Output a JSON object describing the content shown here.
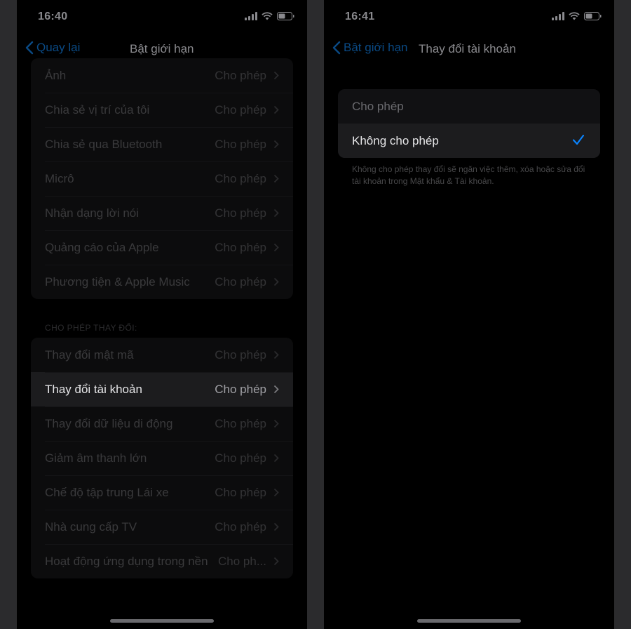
{
  "left": {
    "status": {
      "time": "16:40"
    },
    "nav": {
      "back_label": "Quay lại",
      "title": "Bật giới hạn"
    },
    "privacy_rows": [
      {
        "label": "Ảnh",
        "value": "Cho phép"
      },
      {
        "label": "Chia sẻ vị trí của tôi",
        "value": "Cho phép"
      },
      {
        "label": "Chia sẻ qua Bluetooth",
        "value": "Cho phép"
      },
      {
        "label": "Micrô",
        "value": "Cho phép"
      },
      {
        "label": "Nhận dạng lời nói",
        "value": "Cho phép"
      },
      {
        "label": "Quảng cáo của Apple",
        "value": "Cho phép"
      },
      {
        "label": "Phương tiện & Apple Music",
        "value": "Cho phép"
      }
    ],
    "changes_header": "CHO PHÉP THAY ĐỔI:",
    "change_rows": [
      {
        "label": "Thay đổi mật mã",
        "value": "Cho phép"
      },
      {
        "label": "Thay đổi tài khoản",
        "value": "Cho phép"
      },
      {
        "label": "Thay đổi dữ liệu di động",
        "value": "Cho phép"
      },
      {
        "label": "Giảm âm thanh lớn",
        "value": "Cho phép"
      },
      {
        "label": "Chế độ tập trung Lái xe",
        "value": "Cho phép"
      },
      {
        "label": "Nhà cung cấp TV",
        "value": "Cho phép"
      },
      {
        "label": "Hoạt động ứng dụng trong nền",
        "value": "Cho ph..."
      }
    ]
  },
  "right": {
    "status": {
      "time": "16:41"
    },
    "nav": {
      "back_label": "Bật giới hạn",
      "title": "Thay đổi tài khoản"
    },
    "options": [
      {
        "label": "Cho phép",
        "selected": false
      },
      {
        "label": "Không cho phép",
        "selected": true
      }
    ],
    "footer": "Không cho phép thay đổi sẽ ngăn việc thêm, xóa hoặc sửa đổi tài khoản trong Mật khẩu & Tài khoản."
  },
  "colors": {
    "accent": "#0a84ff",
    "dim_accent": "#0a4a85",
    "background": "#000000",
    "cell": "#1c1c1e"
  },
  "icons": [
    "signal-icon",
    "wifi-icon",
    "battery-icon",
    "back-chevron-icon",
    "chevron-right-icon",
    "checkmark-icon"
  ]
}
